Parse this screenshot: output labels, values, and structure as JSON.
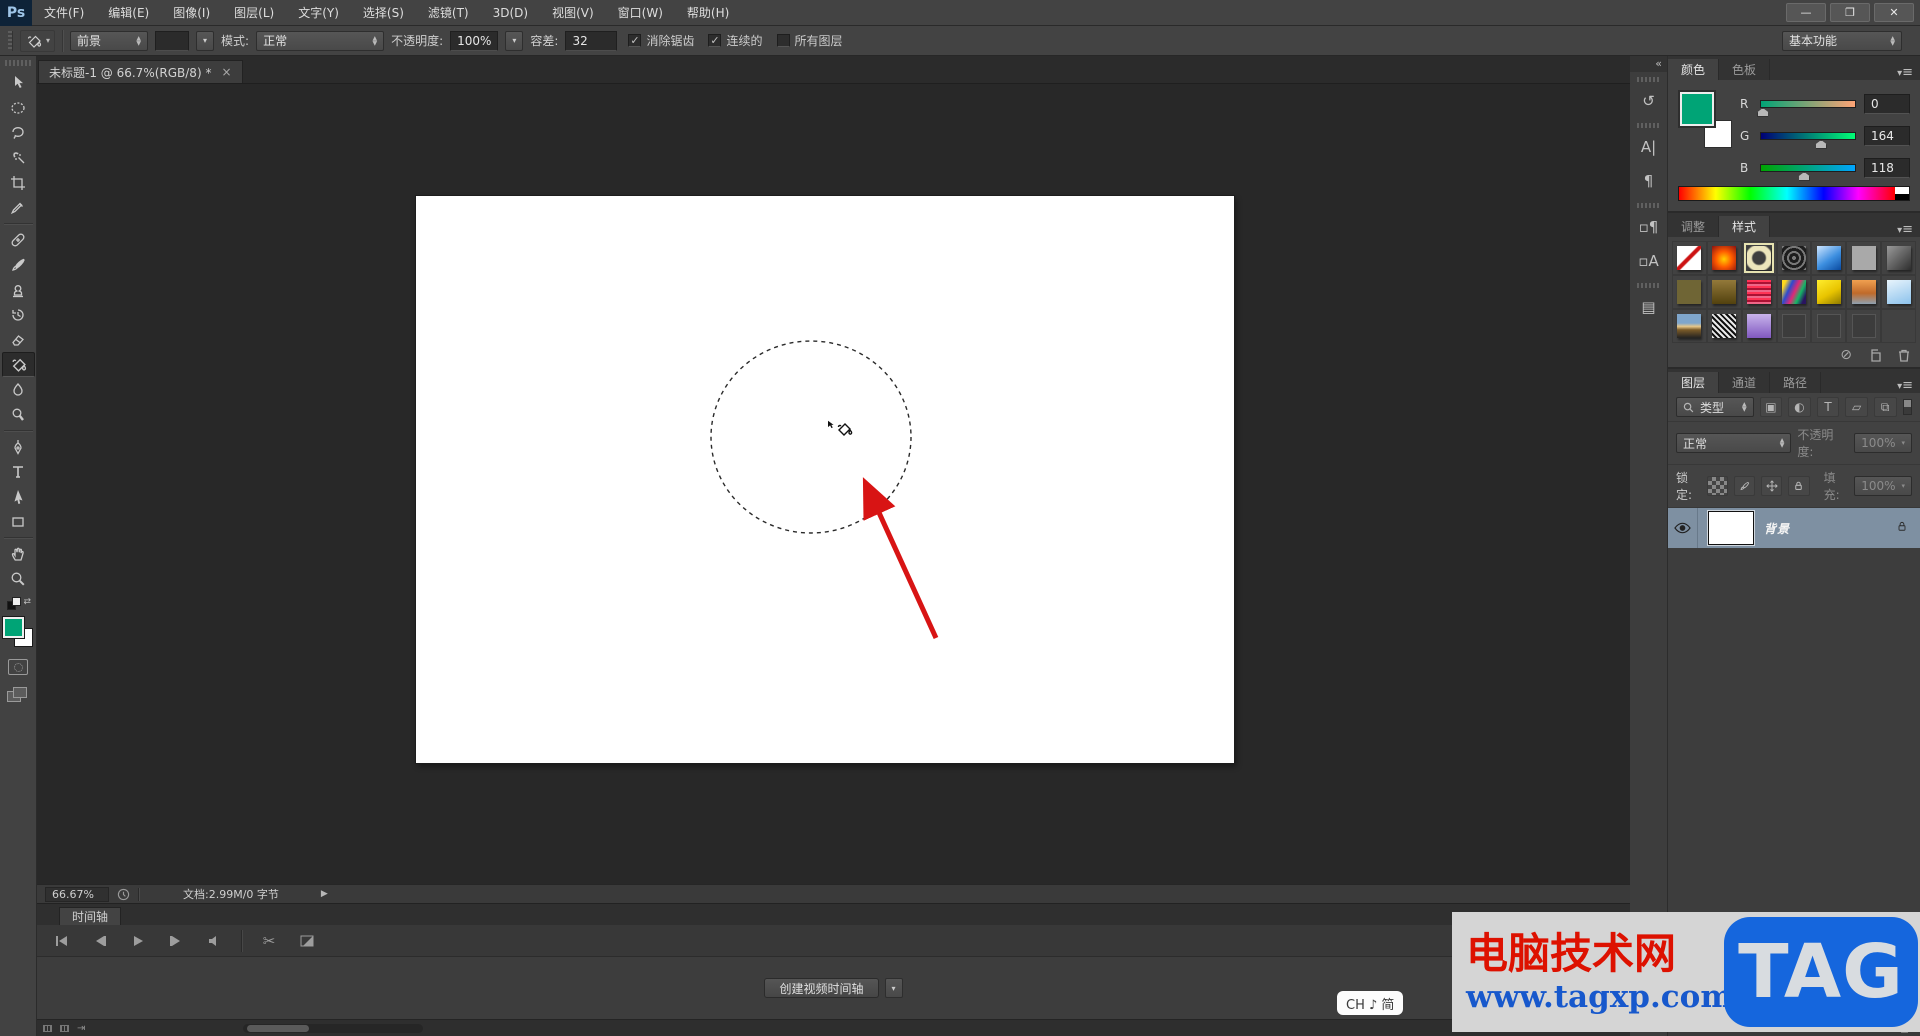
{
  "menu": {
    "logo": "Ps",
    "items": [
      "文件(F)",
      "编辑(E)",
      "图像(I)",
      "图层(L)",
      "文字(Y)",
      "选择(S)",
      "滤镜(T)",
      "3D(D)",
      "视图(V)",
      "窗口(W)",
      "帮助(H)"
    ],
    "window_controls": {
      "minimize": "—",
      "restore": "❐",
      "close": "✕"
    }
  },
  "options": {
    "tool_icon": "paint-bucket",
    "fill_source_value": "前景",
    "mode_label": "模式:",
    "mode_value": "正常",
    "opacity_label": "不透明度:",
    "opacity_value": "100%",
    "tolerance_label": "容差:",
    "tolerance_value": "32",
    "checkboxes": [
      {
        "label": "消除锯齿",
        "cls": "on"
      },
      {
        "label": "连续的",
        "cls": "on"
      },
      {
        "label": "所有图层",
        "cls": ""
      }
    ],
    "workspace_value": "基本功能"
  },
  "document": {
    "tab_title": "未标题-1 @ 66.7%(RGB/8) *",
    "close_glyph": "×"
  },
  "toolbar": {
    "selected_tool": "paint-bucket-tool",
    "foreground_color": "#00a476",
    "background_color": "#ffffff"
  },
  "color_panel": {
    "tabs": {
      "color": "颜色",
      "swatches": "色板"
    },
    "active_tab": "颜色",
    "foreground": "#00a476",
    "channels": [
      {
        "label": "R",
        "value": "0",
        "pct": "2%",
        "grad": "linear-gradient(90deg, rgb(0,164,118), rgb(255,164,118))"
      },
      {
        "label": "G",
        "value": "164",
        "pct": "64%",
        "grad": "linear-gradient(90deg, rgb(0,0,118), rgb(0,255,118))"
      },
      {
        "label": "B",
        "value": "118",
        "pct": "46%",
        "grad": "linear-gradient(90deg, rgb(0,164,0), rgb(0,164,255))"
      }
    ]
  },
  "styles_panel": {
    "tabs": {
      "adjustments": "调整",
      "styles": "样式"
    },
    "active_tab": "样式",
    "swatches": [
      {
        "bg": "linear-gradient(135deg,#ffffff 42%,#cc1111 46%,#cc1111 54%,#ffffff 58%)",
        "cls": ""
      },
      {
        "bg": "radial-gradient(circle at 50% 55%,#ffd000 0%,#ff5a00 45%,#881111 100%)",
        "cls": ""
      },
      {
        "bg": "radial-gradient(circle,#3e3e3e 36%,#ece5bb 46%,#ece5bb 74%,#3e3e3e 84%)",
        "cls": "selected"
      },
      {
        "bg": "repeating-radial-gradient(circle at 50% 50%,#787878 0 2px,#1d1d1d 2px 5px)",
        "cls": ""
      },
      {
        "bg": "linear-gradient(145deg,#cfe6ff 0%,#3d8fe0 55%,#0a4aa0 100%)",
        "cls": ""
      },
      {
        "bg": "#a9a9a9",
        "cls": ""
      },
      {
        "bg": "linear-gradient(135deg,#9a9a9a 0%,#2e2e2e 100%)",
        "cls": ""
      },
      {
        "bg": "#6f6535",
        "cls": ""
      },
      {
        "bg": "linear-gradient(180deg,#93793a 0%,#52410e 100%)",
        "cls": ""
      },
      {
        "bg": "repeating-linear-gradient(180deg,#ff3355 0 2px,#aa1133 2px 4px,#ee6688 4px 6px)",
        "cls": ""
      },
      {
        "bg": "linear-gradient(115deg,#ffd91e 12%,#2b4bd0 32%,#e02a74 52%,#14b864 70%,#2a1460 88%)",
        "cls": ""
      },
      {
        "bg": "linear-gradient(150deg,#ffed2e 0%,#e8c400 55%,#8f7a00 100%)",
        "cls": ""
      },
      {
        "bg": "linear-gradient(180deg,#f0a050 0%,#c06a2a 55%,#8fa0b0 100%)",
        "cls": ""
      },
      {
        "bg": "linear-gradient(160deg,#e8f4fc 0%,#8cc2ec 100%)",
        "cls": ""
      },
      {
        "bg": "linear-gradient(180deg,#7fa6cc 38%,#e8c88a 52%,#7a5a28 66%,#222222 100%)",
        "cls": ""
      },
      {
        "bg": "repeating-linear-gradient(45deg,#e8e8e8 0 2px,#111111 2px 4px)",
        "cls": ""
      },
      {
        "bg": "linear-gradient(180deg,#c8b4ec 0%,#8058c0 100%)",
        "cls": ""
      },
      {
        "bg": "none",
        "cls": "empty"
      },
      {
        "bg": "none",
        "cls": "empty"
      },
      {
        "bg": "none",
        "cls": "empty"
      },
      {
        "bg": "none",
        "cls": "blank"
      }
    ]
  },
  "layers_panel": {
    "tabs": {
      "layers": "图层",
      "channels": "通道",
      "paths": "路径"
    },
    "active_tab": "图层",
    "filter_value": "类型",
    "blend_mode_value": "正常",
    "opacity_label": "不透明度:",
    "opacity_value": "100%",
    "lock_label": "锁定:",
    "fill_label": "填充:",
    "fill_value": "100%",
    "layer": {
      "name": "背景",
      "thumb_color": "#ffffff",
      "visible": true,
      "locked": true,
      "selected": true
    }
  },
  "statusbar": {
    "zoom": "66.67%",
    "doc_info": "文档:2.99M/0 字节",
    "expand_glyph": "▶"
  },
  "timeline": {
    "tab": "时间轴",
    "create_button": "创建视频时间轴"
  },
  "ime_indicator": {
    "text": "CH ♪ 简"
  },
  "watermark": {
    "site_name": "电脑技术网",
    "url": "www.tagxp.com",
    "logo_text": "TAG",
    "name_color": "#dd1100",
    "url_color": "#1758cc",
    "logo_bg": "#1566dd",
    "bg": "#d5d5d5"
  }
}
